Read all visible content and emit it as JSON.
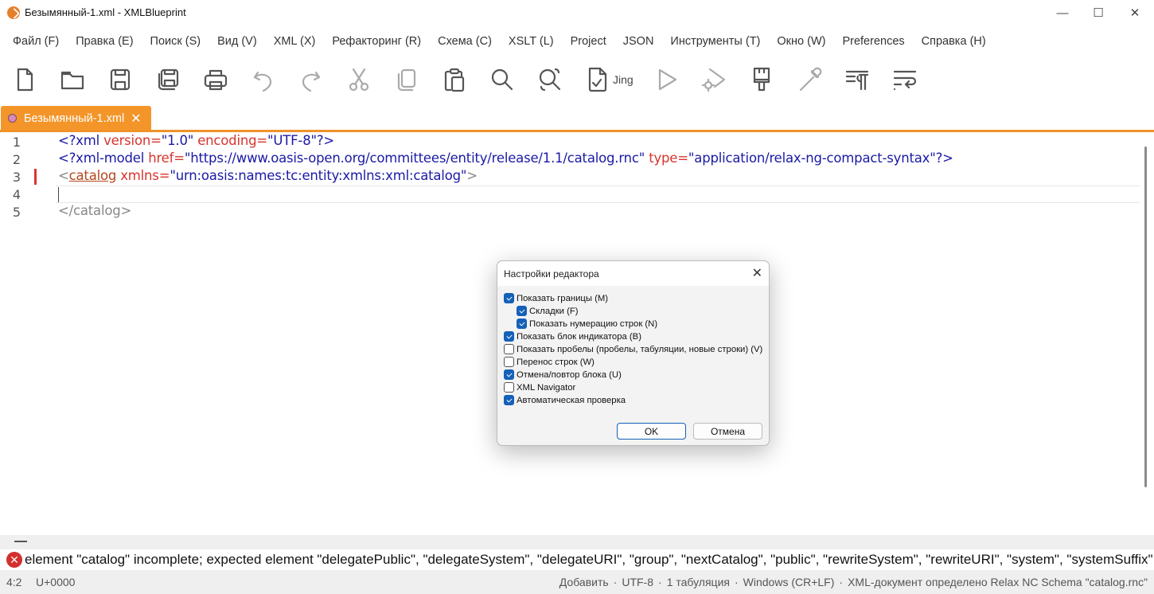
{
  "window": {
    "title": "Безымянный-1.xml - XMLBlueprint",
    "minimize": "—",
    "maximize": "☐",
    "close": "✕"
  },
  "menu": [
    "Файл (F)",
    "Правка (E)",
    "Поиск (S)",
    "Вид (V)",
    "XML (X)",
    "Рефакторинг (R)",
    "Схема (C)",
    "XSLT (L)",
    "Project",
    "JSON",
    "Инструменты (T)",
    "Окно (W)",
    "Preferences",
    "Справка (H)"
  ],
  "toolbar": {
    "jing_label": "Jing",
    "icons": [
      "new-file",
      "open-folder",
      "save",
      "save-all",
      "print",
      "undo",
      "redo",
      "cut",
      "copy",
      "paste",
      "find",
      "find-replace",
      "validate",
      "run",
      "run-settings",
      "format-brush",
      "color-picker",
      "paragraph",
      "word-wrap"
    ]
  },
  "tab": {
    "label": "Безымянный-1.xml",
    "close": "✕"
  },
  "editor": {
    "line_numbers": [
      "1",
      "2",
      "3",
      "4",
      "5"
    ],
    "lines": [
      [
        {
          "t": "<?xml ",
          "c": "pu"
        },
        {
          "t": "version=",
          "c": "at"
        },
        {
          "t": "\"1.0\" ",
          "c": "st"
        },
        {
          "t": "encoding=",
          "c": "at"
        },
        {
          "t": "\"UTF-8\"?>",
          "c": "st"
        }
      ],
      [
        {
          "t": "<?xml-model ",
          "c": "pu"
        },
        {
          "t": "href=",
          "c": "at"
        },
        {
          "t": "\"https://www.oasis-open.org/committees/entity/release/1.1/catalog.rnc\" ",
          "c": "st"
        },
        {
          "t": "type=",
          "c": "at"
        },
        {
          "t": "\"application/relax-ng-compact-syntax\"?>",
          "c": "st"
        }
      ],
      [
        {
          "t": "<",
          "c": "tg"
        },
        {
          "t": "catalog",
          "c": "el"
        },
        {
          "t": " xmlns=",
          "c": "at"
        },
        {
          "t": "\"urn:oasis:names:tc:entity:xmlns:xml:catalog\"",
          "c": "st"
        },
        {
          "t": ">",
          "c": "tg"
        }
      ],
      [],
      [
        {
          "t": "</catalog>",
          "c": "tg"
        }
      ]
    ]
  },
  "error": {
    "icon": "✕",
    "message": "element \"catalog\" incomplete; expected element \"delegatePublic\", \"delegateSystem\", \"delegateURI\", \"group\", \"nextCatalog\", \"public\", \"rewriteSystem\", \"rewriteURI\", \"system\", \"systemSuffix\", \"uri\", \"uriSuffix\""
  },
  "status": {
    "position": "4:2",
    "char": "U+0000",
    "mode": "Добавить",
    "encoding": "UTF-8",
    "indent": "1 табуляция",
    "line_endings": "Windows (CR+LF)",
    "schema": "XML-документ определено Relax NC Schema \"catalog.rnc\"",
    "separator": "·"
  },
  "dialog": {
    "title": "Настройки редактора",
    "close": "✕",
    "options": [
      {
        "label": "Показать границы (M)",
        "checked": true,
        "indent": 0
      },
      {
        "label": "Складки (F)",
        "checked": true,
        "indent": 1
      },
      {
        "label": "Показать нумерацию строк (N)",
        "checked": true,
        "indent": 1
      },
      {
        "label": "Показать блок индикатора (B)",
        "checked": true,
        "indent": 0
      },
      {
        "label": "Показать пробелы (пробелы, табуляции, новые строки) (V)",
        "checked": false,
        "indent": 0
      },
      {
        "label": "Перенос строк (W)",
        "checked": false,
        "indent": 0
      },
      {
        "label": "Отмена/повтор блока (U)",
        "checked": true,
        "indent": 0
      },
      {
        "label": "XML Navigator",
        "checked": false,
        "indent": 0
      },
      {
        "label": "Автоматическая проверка",
        "checked": true,
        "indent": 0
      }
    ],
    "ok": "OK",
    "cancel": "Отмена"
  }
}
